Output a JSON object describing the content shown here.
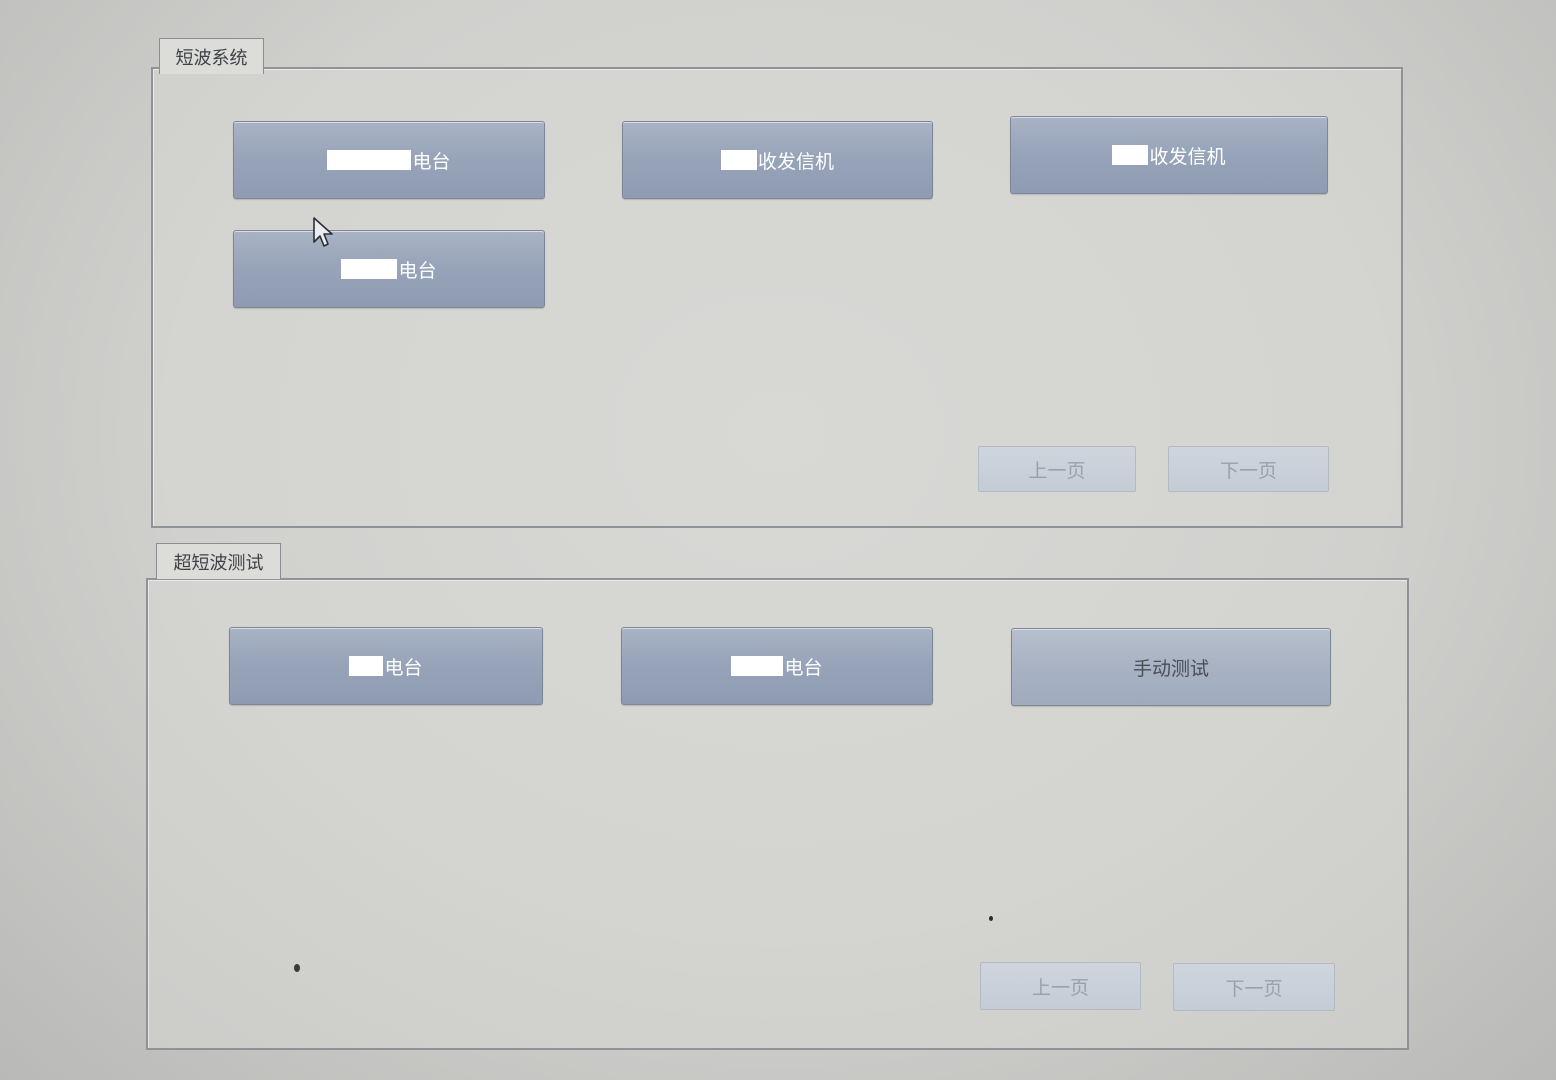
{
  "shortwave_group": {
    "title": "短波系统",
    "buttons": [
      {
        "label": "电台"
      },
      {
        "label": "收发信机"
      },
      {
        "label": "收发信机"
      },
      {
        "label": "电台"
      }
    ],
    "prev_label": "上一页",
    "next_label": "下一页"
  },
  "ultrashort_group": {
    "title": "超短波测试",
    "buttons": [
      {
        "label": "电台"
      },
      {
        "label": "电台"
      },
      {
        "label": "手动测试"
      }
    ],
    "prev_label": "上一页",
    "next_label": "下一页"
  },
  "icons": {
    "cursor": "mouse-pointer-icon"
  },
  "colors": {
    "button_fill": "#98a4b9",
    "disabled_button_fill": "#c5ccd6",
    "panel_border": "#8f9297"
  }
}
